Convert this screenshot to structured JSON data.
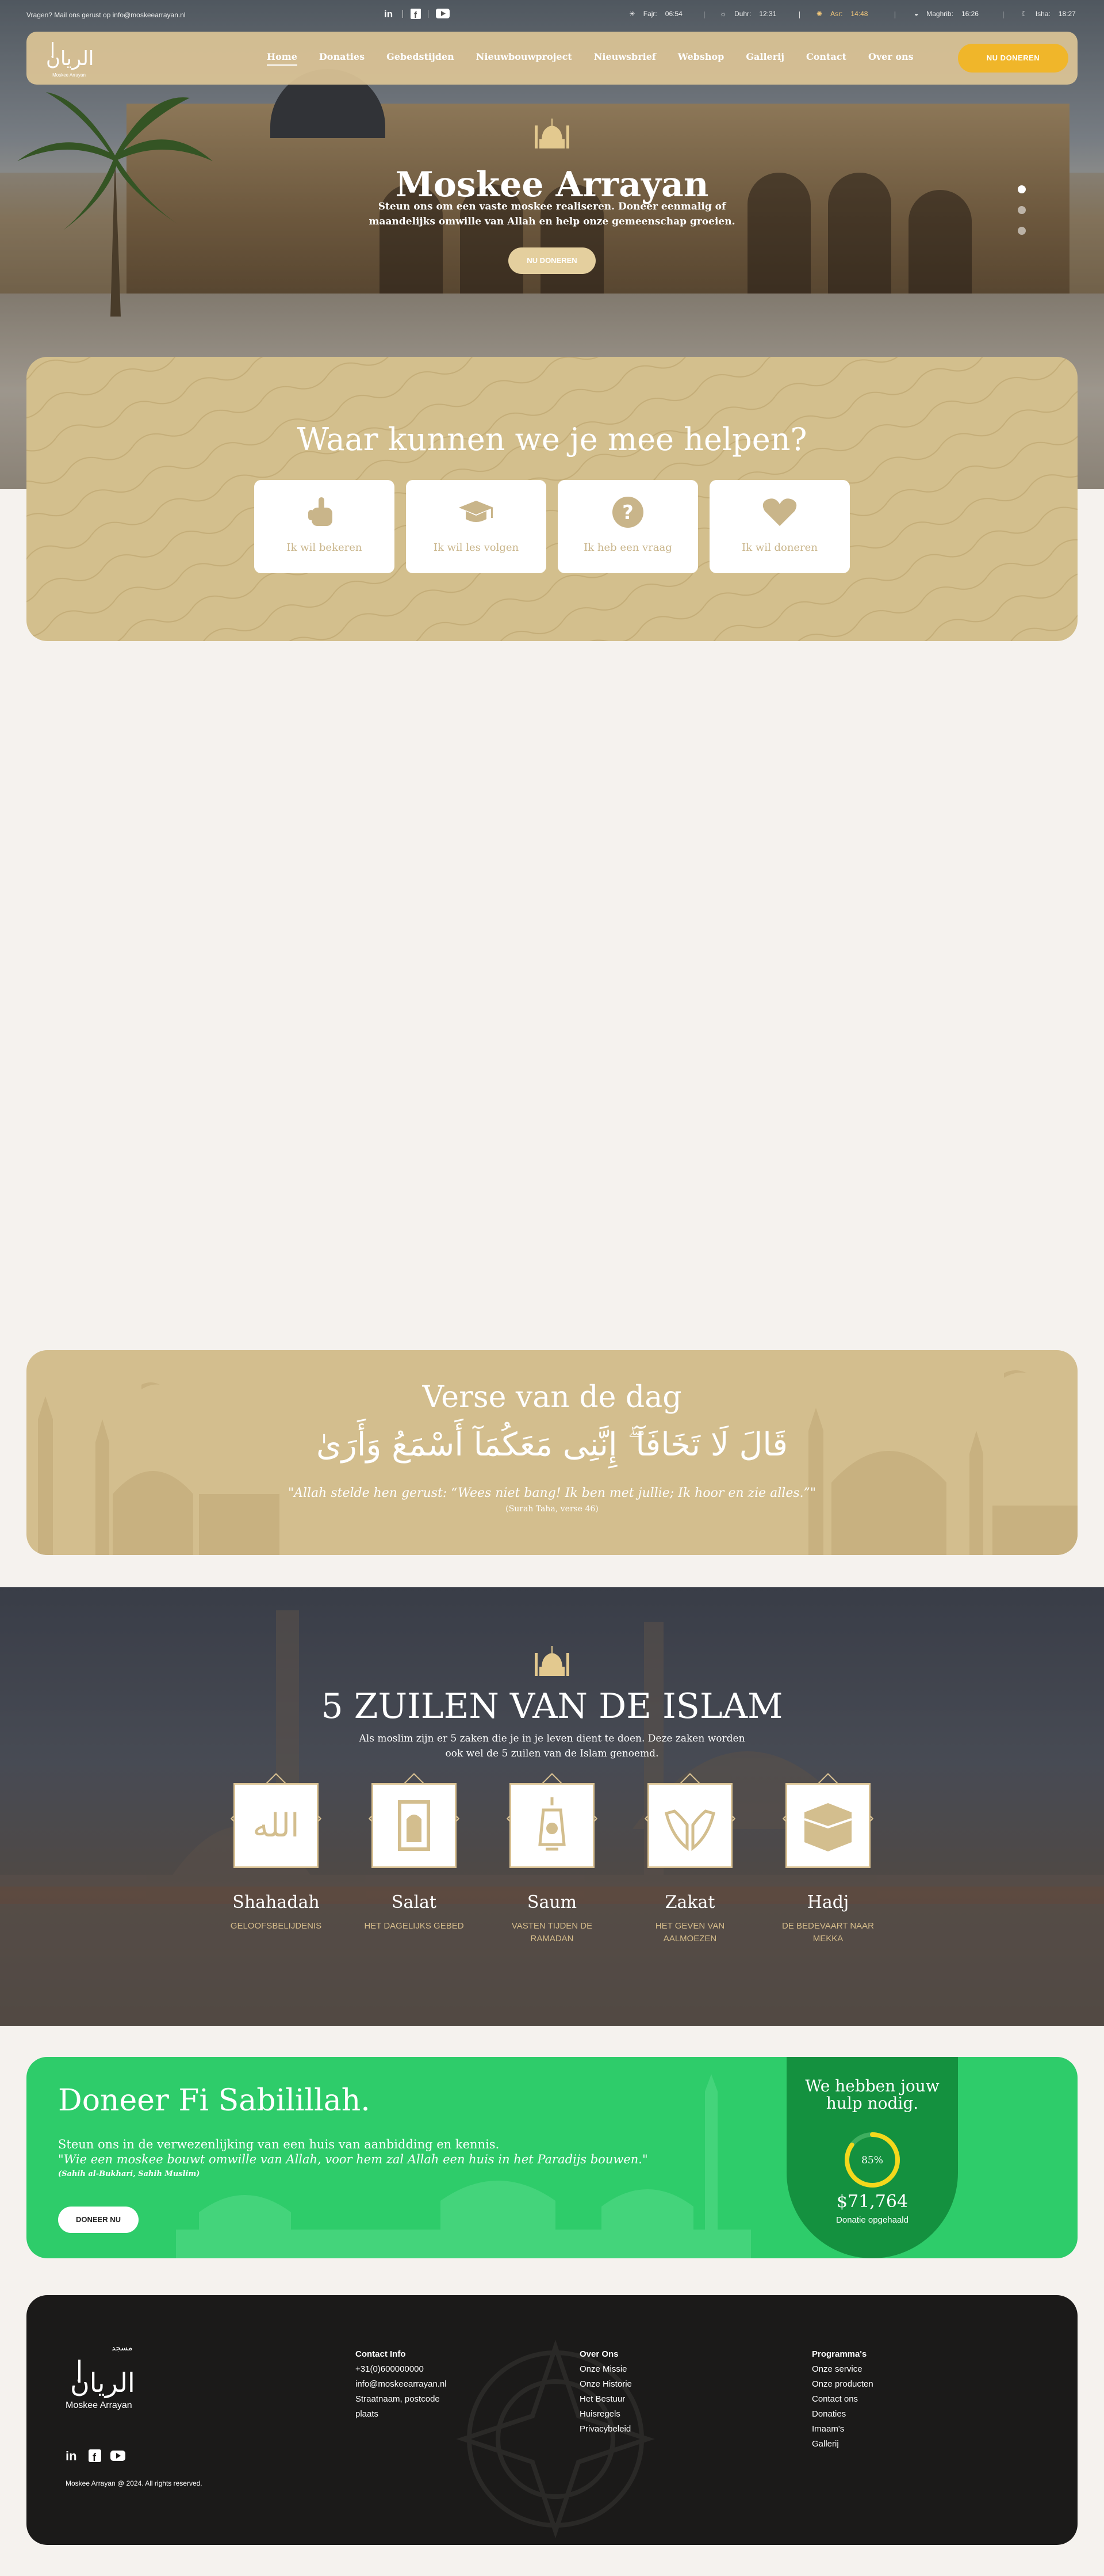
{
  "topbar": {
    "question": "Vragen? Mail ons gerust op info@moskeearrayan.nl",
    "prayer_times": [
      {
        "name": "Fajr:",
        "time": "06:54",
        "icon": "sunrise-icon"
      },
      {
        "name": "Duhr:",
        "time": "12:31",
        "icon": "sun-icon"
      },
      {
        "name": "Asr:",
        "time": "14:48",
        "icon": "sun-high-icon",
        "highlight": true
      },
      {
        "name": "Maghrib:",
        "time": "16:26",
        "icon": "sunset-icon"
      },
      {
        "name": "Isha:",
        "time": "18:27",
        "icon": "moon-icon"
      }
    ]
  },
  "nav": {
    "items": [
      "Home",
      "Donaties",
      "Gebedstijden",
      "Nieuwbouwproject",
      "Nieuwsbrief",
      "Webshop",
      "Gallerij",
      "Contact",
      "Over ons"
    ],
    "donate_label": "NU DONEREN",
    "logo_caption": "Moskee Arrayan"
  },
  "hero": {
    "title": "Moskee Arrayan",
    "subtitle": "Steun ons om een vaste moskee realiseren. Doneer eenmalig of maandelijks omwille van Allah en help onze gemeenschap groeien.",
    "button": "NU DONEREN"
  },
  "help": {
    "title": "Waar kunnen we je mee helpen?",
    "cards": [
      {
        "label": "Ik wil bekeren",
        "icon": "hand-pointing-icon"
      },
      {
        "label": "Ik wil les volgen",
        "icon": "graduation-cap-icon"
      },
      {
        "label": "Ik heb een vraag",
        "icon": "question-icon"
      },
      {
        "label": "Ik wil doneren",
        "icon": "heart-icon"
      }
    ]
  },
  "verse": {
    "title": "Verse van de dag",
    "arabic": "قَالَ لَا تَخَافَآ ۖ إِنَّنِى مَعَكُمَآ أَسْمَعُ وَأَرَىٰ",
    "translation": "\"Allah stelde hen gerust: “Wees niet bang! Ik ben met jullie; Ik hoor en zie alles.”\"",
    "source": "(Surah Taha, verse 46)"
  },
  "pillars": {
    "title": "5 ZUILEN VAN DE ISLAM",
    "subtitle": "Als moslim zijn er 5 zaken die je in je leven dient te doen. Deze zaken worden ook wel de 5 zuilen van de Islam genoemd.",
    "items": [
      {
        "name": "Shahadah",
        "desc": "GELOOFSBELIJDENIS",
        "icon": "allah-calligraphy-icon"
      },
      {
        "name": "Salat",
        "desc": "HET DAGELIJKS GEBED",
        "icon": "prayer-mat-icon"
      },
      {
        "name": "Saum",
        "desc": "VASTEN TIJDEN DE RAMADAN",
        "icon": "lantern-icon"
      },
      {
        "name": "Zakat",
        "desc": "HET GEVEN VAN AALMOEZEN",
        "icon": "open-hands-icon"
      },
      {
        "name": "Hadj",
        "desc": "DE BEDEVAART NAAR MEKKA",
        "icon": "kaaba-icon"
      }
    ]
  },
  "donate": {
    "title": "Doneer Fi Sabilillah.",
    "line1": "Steun ons in de verwezenlijking van een huis van aanbidding en kennis.",
    "quote": "\"Wie een moskee bouwt omwille van Allah, voor hem zal Allah een huis in het Paradijs bouwen.\"",
    "source": "(Sahih al-Bukhari, Sahih Muslim)",
    "button": "DONEER NU",
    "need_title": "We hebben jouw hulp nodig.",
    "progress_pct": 85,
    "progress_label": "85%",
    "amount": "$71,764",
    "amount_label": "Donatie opgehaald"
  },
  "footer": {
    "brand": "Moskee Arrayan",
    "copyright": "Moskee Arrayan @ 2024. All rights reserved.",
    "contact": {
      "heading": "Contact Info",
      "lines": [
        "+31(0)600000000",
        "info@moskeearrayan.nl",
        "Straatnaam, postcode",
        "plaats"
      ]
    },
    "about": {
      "heading": "Over Ons",
      "links": [
        "Onze Missie",
        "Onze Historie",
        "Het Bestuur",
        "Huisregels",
        "Privacybeleid"
      ]
    },
    "program": {
      "heading": "Programma's",
      "links": [
        "Onze service",
        "Onze producten",
        "Contact ons",
        "Donaties",
        "Imaam's",
        "Gallerij"
      ]
    }
  },
  "colors": {
    "gold": "#d3bf8d",
    "accent": "#f0b62a",
    "green": "#2ecc6a",
    "dark_green": "#14913f",
    "footer": "#1b1a19"
  }
}
